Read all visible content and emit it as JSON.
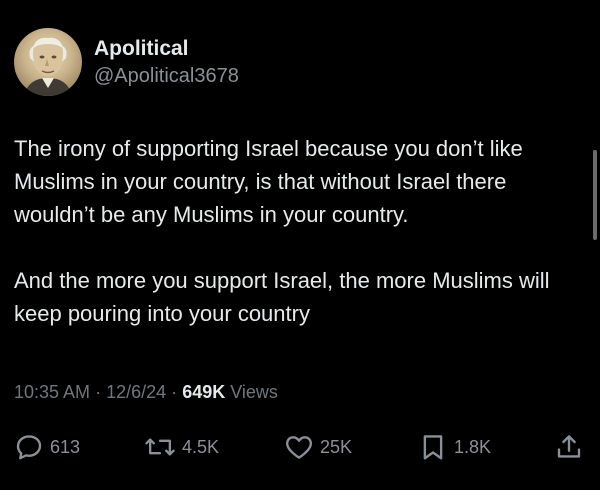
{
  "user": {
    "display_name": "Apolitical",
    "handle": "@Apolitical3678",
    "avatar_icon": "portrait-avatar"
  },
  "tweet": {
    "paragraphs": [
      "The irony of supporting Israel because you don’t like Muslims in your country, is that without Israel there wouldn’t be any Muslims in your country.",
      "And the more you support Israel, the more Muslims will keep pouring into your country"
    ]
  },
  "meta": {
    "time": "10:35 AM",
    "date": "12/6/24",
    "separator": "·",
    "views_count": "649K",
    "views_label": "Views"
  },
  "actions": {
    "replies": "613",
    "reposts": "4.5K",
    "likes": "25K",
    "bookmarks": "1.8K"
  },
  "colors": {
    "background": "#000000",
    "text": "#e7e9ea",
    "secondary": "#71767b"
  }
}
